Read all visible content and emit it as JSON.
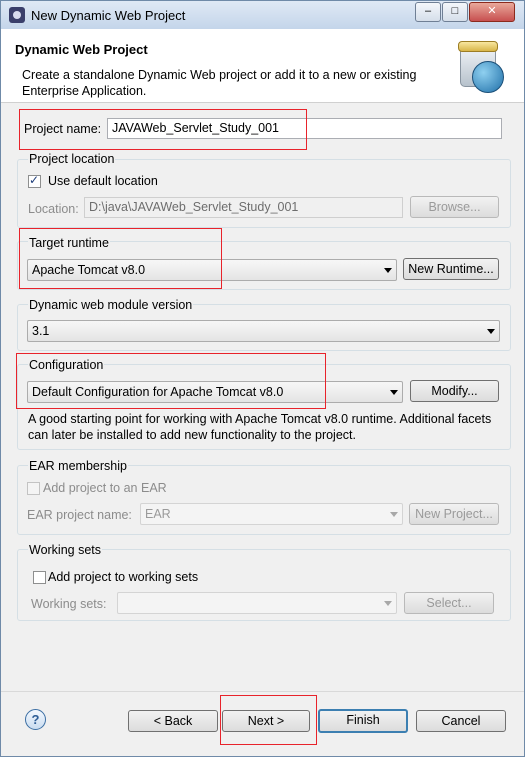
{
  "window": {
    "title": "New Dynamic Web Project",
    "controls": {
      "minimize": "–",
      "maximize": "□",
      "close": "✕"
    }
  },
  "header": {
    "title": "Dynamic Web Project",
    "description": "Create a standalone Dynamic Web project or add it to a new or existing Enterprise Application."
  },
  "project_name": {
    "label": "Project name:",
    "value": "JAVAWeb_Servlet_Study_001"
  },
  "project_location": {
    "group_label": "Project location",
    "use_default_label": "Use default location",
    "use_default_checked": true,
    "location_label": "Location:",
    "location_value": "D:\\java\\JAVAWeb_Servlet_Study_001",
    "browse_label": "Browse..."
  },
  "target_runtime": {
    "group_label": "Target runtime",
    "selected": "Apache Tomcat v8.0",
    "new_runtime_label": "New Runtime..."
  },
  "module_version": {
    "group_label": "Dynamic web module version",
    "selected": "3.1"
  },
  "configuration": {
    "group_label": "Configuration",
    "selected": "Default Configuration for Apache Tomcat v8.0",
    "modify_label": "Modify...",
    "description": "A good starting point for working with Apache Tomcat v8.0 runtime. Additional facets can later be installed to add new functionality to the project."
  },
  "ear_membership": {
    "group_label": "EAR membership",
    "add_label": "Add project to an EAR",
    "add_checked": false,
    "project_name_label": "EAR project name:",
    "project_name_value": "EAR",
    "new_project_label": "New Project..."
  },
  "working_sets": {
    "group_label": "Working sets",
    "add_label": "Add project to working sets",
    "add_checked": false,
    "sets_label": "Working sets:",
    "sets_value": "",
    "select_label": "Select..."
  },
  "footer": {
    "help": "?",
    "back_label": "< Back",
    "next_label": "Next >",
    "finish_label": "Finish",
    "cancel_label": "Cancel"
  },
  "colors": {
    "highlight_box": "#e8232b",
    "title_bar": "#c4d5ea",
    "default_button_border": "#3c7fb1"
  }
}
